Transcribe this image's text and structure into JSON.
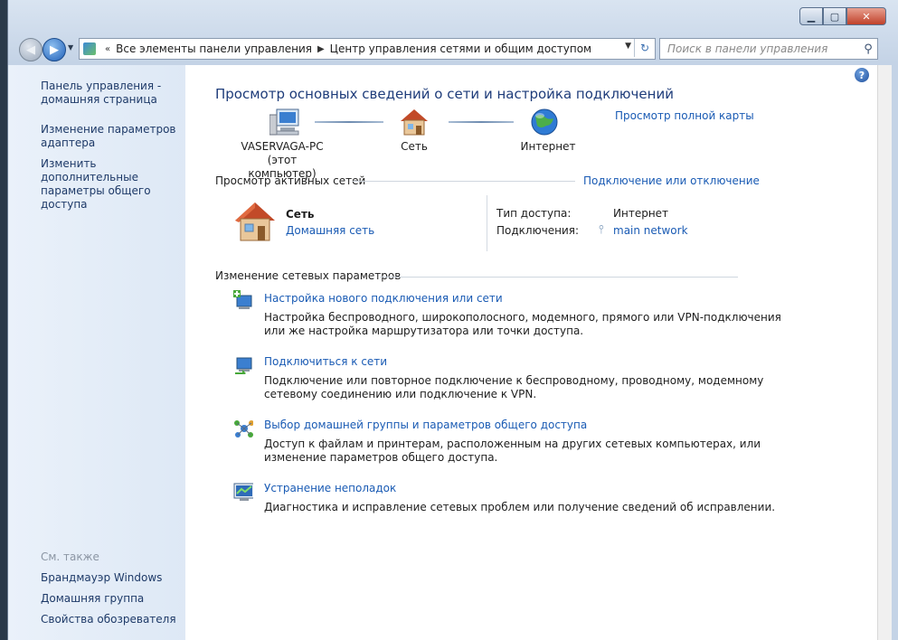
{
  "window": {
    "caption_min": "▁",
    "caption_max": "▢",
    "caption_close": "✕"
  },
  "nav": {
    "breadcrumb": [
      "Все элементы панели управления",
      "Центр управления сетями и общим доступом"
    ],
    "search_placeholder": "Поиск в панели управления",
    "icons": {
      "back": "arrow-left-icon",
      "forward": "arrow-right-icon",
      "refresh": "refresh-icon",
      "search": "search-icon"
    }
  },
  "sidebar": {
    "links": [
      "Панель управления - домашняя страница",
      "Изменение параметров адаптера",
      "Изменить дополнительные параметры общего доступа"
    ],
    "see_also_heading": "См. также",
    "see_also_links": [
      "Брандмауэр Windows",
      "Домашняя группа",
      "Свойства обозревателя"
    ]
  },
  "main": {
    "title": "Просмотр основных сведений о сети и настройка подключений",
    "full_map_link": "Просмотр полной карты",
    "map": {
      "computer_name": "VASERVAGA-PC",
      "computer_sub": "(этот компьютер)",
      "network": "Сеть",
      "internet": "Интернет"
    },
    "active": {
      "heading": "Просмотр активных сетей",
      "connect_link": "Подключение или отключение",
      "network_name": "Сеть",
      "network_type": "Домашняя сеть",
      "access_label": "Тип доступа:",
      "access_value": "Интернет",
      "connections_label": "Подключения:",
      "connections_value": "main network"
    },
    "change": {
      "heading": "Изменение сетевых параметров",
      "tasks": [
        {
          "title": "Настройка нового подключения или сети",
          "desc1": "Настройка беспроводного, широкополосного, модемного, прямого или VPN-подключения",
          "desc2": "или же настройка маршрутизатора или точки доступа."
        },
        {
          "title": "Подключиться к сети",
          "desc1": "Подключение или повторное подключение к беспроводному, проводному, модемному",
          "desc2": "сетевому соединению или подключение к VPN."
        },
        {
          "title": "Выбор домашней группы и параметров общего доступа",
          "desc1": "Доступ к файлам и принтерам, расположенным на других сетевых компьютерах, или",
          "desc2": "изменение параметров общего доступа."
        },
        {
          "title": "Устранение неполадок",
          "desc1": "Диагностика и исправление сетевых проблем или получение сведений об исправлении."
        }
      ]
    }
  }
}
